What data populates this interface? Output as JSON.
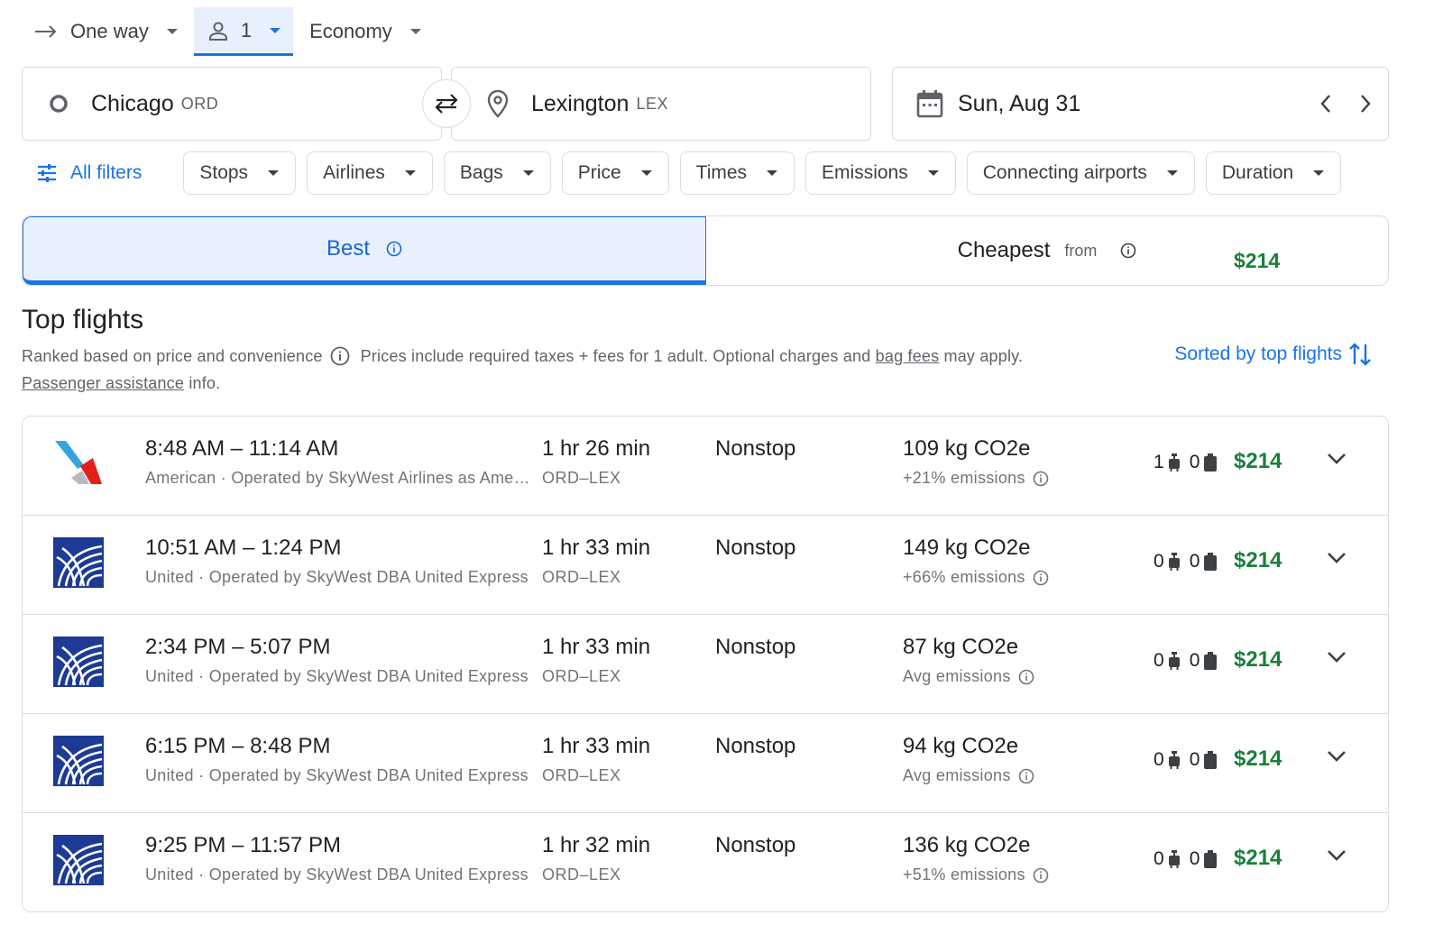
{
  "colors": {
    "accent": "#1a73e8",
    "price": "#188038",
    "border": "#dadce0",
    "selected_tab_bg": "#e8f0fe"
  },
  "trip": {
    "type_label": "One way",
    "passengers": "1",
    "cabin": "Economy"
  },
  "search": {
    "origin_city": "Chicago",
    "origin_code": "ORD",
    "destination_city": "Lexington",
    "destination_code": "LEX",
    "date": "Sun, Aug 31"
  },
  "filters": {
    "all_label": "All filters",
    "chips": [
      "Stops",
      "Airlines",
      "Bags",
      "Price",
      "Times",
      "Emissions",
      "Connecting airports",
      "Duration"
    ]
  },
  "sort_tabs": {
    "best": "Best",
    "cheapest": "Cheapest",
    "from": "from",
    "cheapest_price": "$214"
  },
  "results": {
    "title": "Top flights",
    "ranked": "Ranked based on price and convenience",
    "prices_note": "Prices include required taxes + fees for 1 adult. Optional charges and",
    "bag_fees": "bag fees",
    "may_apply": "may apply.",
    "passenger_assistance": "Passenger assistance",
    "info": "info.",
    "sorted_label": "Sorted by top flights"
  },
  "flights": [
    {
      "logo": "american-airlines-logo",
      "times": "8:48 AM – 11:14 AM",
      "airline": "American · Operated by SkyWest Airlines as American Eagle",
      "duration": "1 hr 26 min",
      "route": "ORD–LEX",
      "stops": "Nonstop",
      "co2": "109 kg CO2e",
      "emissions": "+21% emissions",
      "carry_on": "1",
      "checked": "0",
      "price": "$214"
    },
    {
      "logo": "united-airlines-logo",
      "times": "10:51 AM – 1:24 PM",
      "airline": "United · Operated by SkyWest DBA United Express",
      "duration": "1 hr 33 min",
      "route": "ORD–LEX",
      "stops": "Nonstop",
      "co2": "149 kg CO2e",
      "emissions": "+66% emissions",
      "carry_on": "0",
      "checked": "0",
      "price": "$214"
    },
    {
      "logo": "united-airlines-logo",
      "times": "2:34 PM – 5:07 PM",
      "airline": "United · Operated by SkyWest DBA United Express",
      "duration": "1 hr 33 min",
      "route": "ORD–LEX",
      "stops": "Nonstop",
      "co2": "87 kg CO2e",
      "emissions": "Avg emissions",
      "carry_on": "0",
      "checked": "0",
      "price": "$214"
    },
    {
      "logo": "united-airlines-logo",
      "times": "6:15 PM – 8:48 PM",
      "airline": "United · Operated by SkyWest DBA United Express",
      "duration": "1 hr 33 min",
      "route": "ORD–LEX",
      "stops": "Nonstop",
      "co2": "94 kg CO2e",
      "emissions": "Avg emissions",
      "carry_on": "0",
      "checked": "0",
      "price": "$214"
    },
    {
      "logo": "united-airlines-logo",
      "times": "9:25 PM – 11:57 PM",
      "airline": "United · Operated by SkyWest DBA United Express",
      "duration": "1 hr 32 min",
      "route": "ORD–LEX",
      "stops": "Nonstop",
      "co2": "136 kg CO2e",
      "emissions": "+51% emissions",
      "carry_on": "0",
      "checked": "0",
      "price": "$214"
    }
  ]
}
